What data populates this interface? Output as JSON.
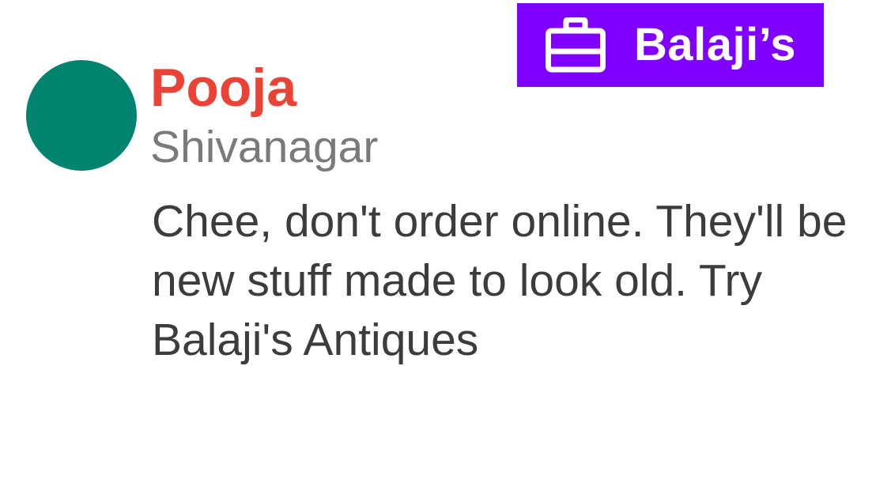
{
  "comment": {
    "author": {
      "name": "Pooja",
      "location": "Shivanagar",
      "name_color": "#ea4335",
      "avatar_color": "#00836f"
    },
    "text": "Chee, don't order online. They'll be new stuff made to look old. Try Balaji's Antiques"
  },
  "store_chip": {
    "label": "Balaji’s",
    "icon": "shopping-bag-icon",
    "background": "#7f00ff"
  }
}
